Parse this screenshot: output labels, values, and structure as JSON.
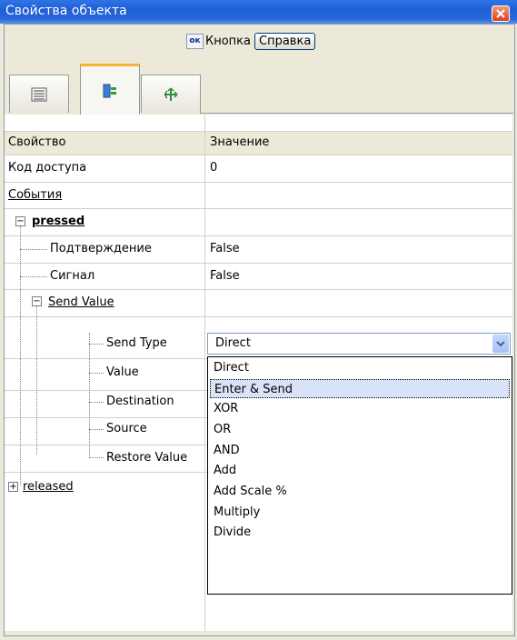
{
  "window": {
    "title": "Свойства объекта"
  },
  "toolbar": {
    "ok_icon": "ок",
    "object_name": "Кнопка",
    "help_button": "Справка"
  },
  "tabs": [
    {
      "icon": "list-icon",
      "active": false
    },
    {
      "icon": "events-icon",
      "active": true
    },
    {
      "icon": "move-icon",
      "active": false
    }
  ],
  "grid": {
    "col_property": "Свойство",
    "col_value": "Значение",
    "rows": {
      "access_code": {
        "label": "Код доступа",
        "value": "0"
      },
      "events": {
        "label": "События"
      },
      "pressed": {
        "label": "pressed"
      },
      "confirm": {
        "label": "Подтверждение",
        "value": "False"
      },
      "signal": {
        "label": "Сигнал",
        "value": "False"
      },
      "send_value": {
        "label": "Send Value"
      },
      "send_type": {
        "label": "Send Type"
      },
      "value": {
        "label": "Value"
      },
      "destination": {
        "label": "Destination"
      },
      "source": {
        "label": "Source"
      },
      "restore_value": {
        "label": "Restore Value"
      },
      "released": {
        "label": "released"
      }
    }
  },
  "dropdown": {
    "selected_value": "Direct",
    "options": [
      "Direct",
      "Enter & Send",
      "XOR",
      "OR",
      "AND",
      "Add",
      "Add Scale %",
      "Multiply",
      "Divide"
    ],
    "highlighted_option": "Enter & Send"
  },
  "colors": {
    "title_bar": "#1f5fd6",
    "tab_accent": "#f7b23b",
    "highlight": "#d8e3f7"
  }
}
